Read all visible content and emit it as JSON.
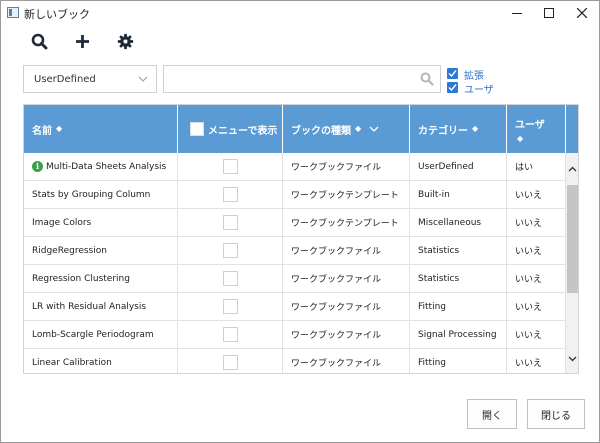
{
  "window": {
    "title": "新しいブック"
  },
  "toolbar": {
    "icons": [
      "search-icon",
      "plus-icon",
      "gear-icon"
    ]
  },
  "filter": {
    "dropdown_value": "UserDefined",
    "search_value": "",
    "search_placeholder": ""
  },
  "checkboxes": [
    {
      "label": "拡張",
      "checked": true
    },
    {
      "label": "ユーザ",
      "checked": true
    }
  ],
  "table": {
    "columns": [
      "名前",
      "メニューで表示",
      "ブックの種類",
      "カテゴリー",
      "ユーザ"
    ],
    "rows": [
      {
        "name": "Multi-Data Sheets Analysis",
        "info": true,
        "menu": false,
        "type": "ワークブックファイル",
        "category": "UserDefined",
        "user": "はい"
      },
      {
        "name": "Stats by Grouping Column",
        "info": false,
        "menu": false,
        "type": "ワークブックテンプレート",
        "category": "Built-in",
        "user": "いいえ"
      },
      {
        "name": "Image Colors",
        "info": false,
        "menu": false,
        "type": "ワークブックテンプレート",
        "category": "Miscellaneous",
        "user": "いいえ"
      },
      {
        "name": "RidgeRegression",
        "info": false,
        "menu": false,
        "type": "ワークブックファイル",
        "category": "Statistics",
        "user": "いいえ"
      },
      {
        "name": "Regression Clustering",
        "info": false,
        "menu": false,
        "type": "ワークブックファイル",
        "category": "Statistics",
        "user": "いいえ"
      },
      {
        "name": "LR with Residual Analysis",
        "info": false,
        "menu": false,
        "type": "ワークブックファイル",
        "category": "Fitting",
        "user": "いいえ"
      },
      {
        "name": "Lomb-Scargle Periodogram",
        "info": false,
        "menu": false,
        "type": "ワークブックファイル",
        "category": "Signal Processing",
        "user": "いいえ"
      },
      {
        "name": "Linear Calibration",
        "info": false,
        "menu": false,
        "type": "ワークブックファイル",
        "category": "Fitting",
        "user": "いいえ"
      }
    ]
  },
  "buttons": {
    "open": "開く",
    "close": "閉じる"
  },
  "colors": {
    "header": "#5b9bd5",
    "checkbox": "#2f78d4",
    "info": "#3aa04a"
  }
}
